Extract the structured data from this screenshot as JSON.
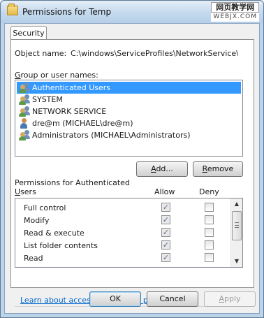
{
  "window": {
    "title": "Permissions for Temp"
  },
  "watermark": {
    "line1": "网页教学网",
    "line2": "WEBJX.COM"
  },
  "tabs": [
    {
      "label": "Security",
      "active": true
    }
  ],
  "object": {
    "label": "Object name:",
    "value": "C:\\windows\\ServiceProfiles\\NetworkService\\AppI"
  },
  "group_label": {
    "prefix": "",
    "accel": "G",
    "rest": "roup or user names:"
  },
  "users": [
    {
      "name": "Authenticated Users",
      "icon": "group-icon",
      "selected": true
    },
    {
      "name": "SYSTEM",
      "icon": "group-icon",
      "selected": false
    },
    {
      "name": "NETWORK SERVICE",
      "icon": "group-icon",
      "selected": false
    },
    {
      "name": "dre@m (MICHAEL\\dre@m)",
      "icon": "user-icon",
      "selected": false
    },
    {
      "name": "Administrators (MICHAEL\\Administrators)",
      "icon": "group-icon",
      "selected": false
    }
  ],
  "buttons": {
    "add": {
      "before": "",
      "accel": "A",
      "after": "dd..."
    },
    "remove": {
      "before": "",
      "accel": "R",
      "after": "emove"
    },
    "ok": "OK",
    "cancel": "Cancel",
    "apply": {
      "before": "",
      "accel": "A",
      "after": "pply"
    }
  },
  "permissions": {
    "label_line1": "Permissions for Authenticated",
    "label_line2_accel": "U",
    "label_line2_rest": "sers",
    "allow_header": "Allow",
    "deny_header": "Deny",
    "rows": [
      {
        "name": "Full control",
        "allow": true,
        "deny": false
      },
      {
        "name": "Modify",
        "allow": true,
        "deny": false
      },
      {
        "name": "Read & execute",
        "allow": true,
        "deny": false
      },
      {
        "name": "List folder contents",
        "allow": true,
        "deny": false
      },
      {
        "name": "Read",
        "allow": true,
        "deny": false
      }
    ]
  },
  "link": "Learn about access control and permissions",
  "colors": {
    "selection": "#3399ff",
    "link": "#0066cc",
    "titlebar": "#c4d9ed"
  }
}
